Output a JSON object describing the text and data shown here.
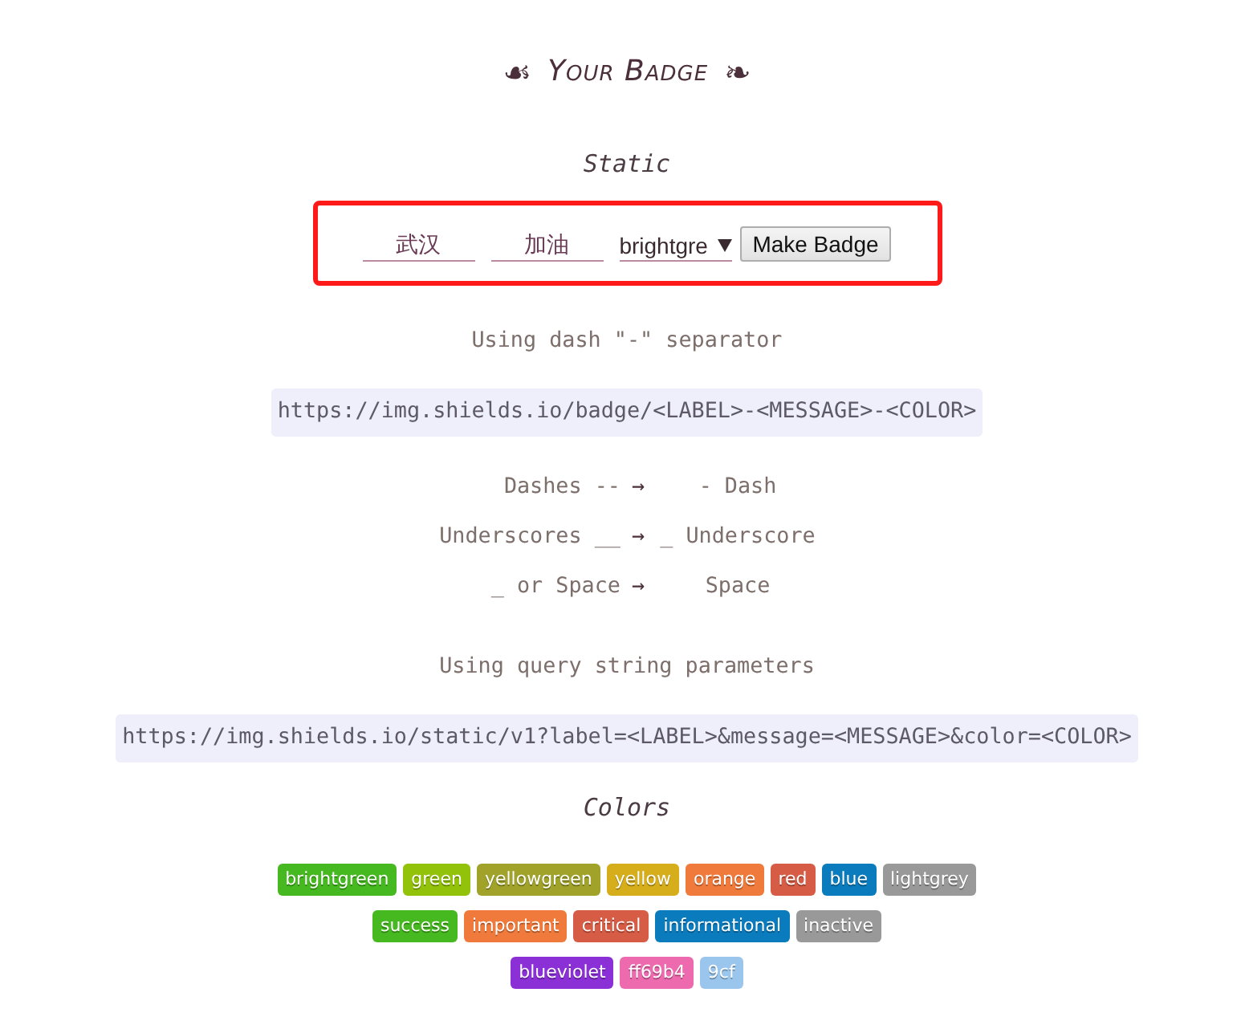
{
  "header": {
    "ornament_left": "☙",
    "title": "Your Badge",
    "ornament_right": "❧"
  },
  "static": {
    "heading": "Static",
    "form": {
      "highlighted": true,
      "label_field": {
        "value": "武汉"
      },
      "message_field": {
        "value": "加油"
      },
      "color_select": {
        "value": "brightgre"
      },
      "button": "Make Badge"
    },
    "methods": [
      {
        "caption": "Using dash \"-\" separator",
        "url": "https://img.shields.io/badge/<LABEL>-<MESSAGE>-<COLOR>",
        "rules": [
          {
            "source": "Dashes --",
            "arrow": "→",
            "result": "- Dash"
          },
          {
            "source": "Underscores __",
            "arrow": "→",
            "result": "_ Underscore"
          },
          {
            "source": "_ or Space",
            "arrow": "→",
            "result": "Space"
          }
        ]
      },
      {
        "caption": "Using query string parameters",
        "url": "https://img.shields.io/static/v1?label=<LABEL>&message=<MESSAGE>&color=<COLOR>"
      }
    ]
  },
  "colors": {
    "heading": "Colors",
    "groups": [
      {
        "badges": [
          {
            "label": "brightgreen",
            "color": "#45b91f"
          },
          {
            "label": "green",
            "color": "#93c20a"
          },
          {
            "label": "yellowgreen",
            "color": "#a0a229"
          },
          {
            "label": "yellow",
            "color": "#d6ad1a"
          },
          {
            "label": "orange",
            "color": "#ef7a3b"
          },
          {
            "label": "red",
            "color": "#d65c45"
          },
          {
            "label": "blue",
            "color": "#0a7bbd"
          },
          {
            "label": "lightgrey",
            "color": "#999999"
          }
        ]
      },
      {
        "badges": [
          {
            "label": "success",
            "color": "#45b91f"
          },
          {
            "label": "important",
            "color": "#ef7a3b"
          },
          {
            "label": "critical",
            "color": "#d65c45"
          },
          {
            "label": "informational",
            "color": "#0a7bbd"
          },
          {
            "label": "inactive",
            "color": "#999999"
          }
        ]
      },
      {
        "badges": [
          {
            "label": "blueviolet",
            "color": "#8b2fd6"
          },
          {
            "label": "ff69b4",
            "color": "#ee6aae"
          },
          {
            "label": "9cf",
            "color": "#9ac6ee"
          }
        ]
      }
    ]
  }
}
